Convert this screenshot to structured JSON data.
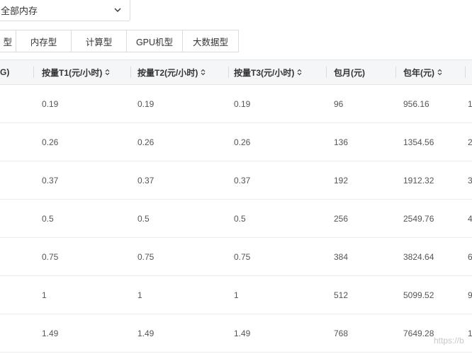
{
  "memory_select": {
    "value": "全部内存"
  },
  "tabs": [
    {
      "label": "型"
    },
    {
      "label": "内存型"
    },
    {
      "label": "计算型"
    },
    {
      "label": "GPU机型"
    },
    {
      "label": "大数据型"
    }
  ],
  "table": {
    "headers": {
      "mem": "G)",
      "t1": "按量T1(元/小时)",
      "t2": "按量T2(元/小时)",
      "t3": "按量T3(元/小时)",
      "month": "包月(元)",
      "year": "包年(元)"
    },
    "rows": [
      {
        "t1": "0.19",
        "t2": "0.19",
        "t3": "0.19",
        "month": "96",
        "year": "956.16",
        "next": "1"
      },
      {
        "t1": "0.26",
        "t2": "0.26",
        "t3": "0.26",
        "month": "136",
        "year": "1354.56",
        "next": "2"
      },
      {
        "t1": "0.37",
        "t2": "0.37",
        "t3": "0.37",
        "month": "192",
        "year": "1912.32",
        "next": "3"
      },
      {
        "t1": "0.5",
        "t2": "0.5",
        "t3": "0.5",
        "month": "256",
        "year": "2549.76",
        "next": "4"
      },
      {
        "t1": "0.75",
        "t2": "0.75",
        "t3": "0.75",
        "month": "384",
        "year": "3824.64",
        "next": "6"
      },
      {
        "t1": "1",
        "t2": "1",
        "t3": "1",
        "month": "512",
        "year": "5099.52",
        "next": "9"
      },
      {
        "t1": "1.49",
        "t2": "1.49",
        "t3": "1.49",
        "month": "768",
        "year": "7649.28",
        "next": "1"
      }
    ]
  },
  "watermark": "https://b"
}
